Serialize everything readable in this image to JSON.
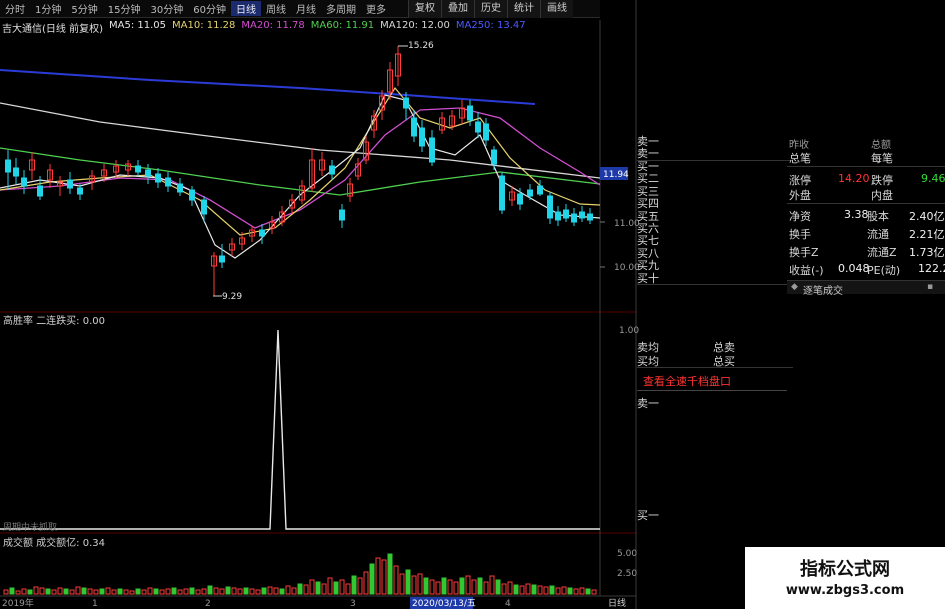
{
  "toolbar": {
    "periods": [
      "分时",
      "1分钟",
      "5分钟",
      "15分钟",
      "30分钟",
      "60分钟",
      "日线",
      "周线",
      "月线",
      "多周期",
      "更多"
    ],
    "active_period": "日线",
    "buttons": [
      "复权",
      "叠加",
      "历史",
      "统计",
      "画线"
    ]
  },
  "ma_legend": {
    "title": "吉大通信(日线 前复权)",
    "ma5": "MA5: 11.05",
    "ma10": "MA10: 11.28",
    "ma20": "MA20: 11.78",
    "ma60": "MA60: 11.91",
    "ma120": "MA120: 12.00",
    "ma250": "MA250: 13.47"
  },
  "price_chart": {
    "high_label": "15.26",
    "low_label": "9.29",
    "current_price_tag": "11.94",
    "y_ticks": [
      "11.00",
      "10.00"
    ],
    "colors": {
      "up": "#ff3b3b",
      "down": "#22d4e8",
      "ma5": "#e8e8e8",
      "ma10": "#e6d36c",
      "ma20": "#d04fd0",
      "ma60": "#4fd04f",
      "ma120": "#d8d8d8",
      "ma250": "#2b3bd8"
    }
  },
  "indicator_panel": {
    "title": "高胜率  二连跌买: 0.00",
    "y_ticks": [
      "1.00"
    ],
    "footer_text": "周期中未抓取"
  },
  "volume_panel": {
    "title": "成交额  成交额亿: 0.34",
    "y_ticks": [
      "5.00",
      "2.50"
    ]
  },
  "date_axis": {
    "labels": [
      "2019年",
      "1",
      "2",
      "3",
      "4"
    ],
    "highlight_date": "2020/03/13/五",
    "period_label": "日线"
  },
  "order_book": {
    "sell_levels": [
      "卖一",
      "卖一"
    ],
    "buy_levels": [
      "买一",
      "买二",
      "买三",
      "买四",
      "买五",
      "买六",
      "买七",
      "买八",
      "买九",
      "买十"
    ],
    "sell_avg_label": "卖均",
    "buy_avg_label": "买均",
    "total_sell_label": "总卖",
    "total_buy_label": "总买",
    "view_all_link": "查看全速千档盘口",
    "lower_sell_label": "卖一",
    "lower_buy_label": "买一"
  },
  "stats": {
    "header_left": "昨收",
    "header_right": "总额",
    "total_trades_label": "总笔",
    "per_trade_label": "每笔",
    "limit_up_label": "涨停",
    "limit_up_value": "14.20",
    "limit_down_label": "跌停",
    "limit_down_value": "9.46",
    "outer_label": "外盘",
    "inner_label": "内盘",
    "net_assets_label": "净资",
    "net_assets_value": "3.38",
    "share_capital_label": "股本",
    "share_capital_value": "2.40亿",
    "turnover_label": "换手",
    "float_label": "流通",
    "float_value": "2.21亿",
    "turnover_z_label": "换手Z",
    "float_z_label": "流通Z",
    "float_z_value": "1.73亿",
    "eps_label": "收益(-)",
    "eps_value": "0.048",
    "pe_label": "PE(动)",
    "pe_value": "122.2",
    "trade_detail_title": "逐笔成交"
  },
  "watermark": {
    "title": "指标公式网",
    "url": "www.zbgs3.com"
  }
}
